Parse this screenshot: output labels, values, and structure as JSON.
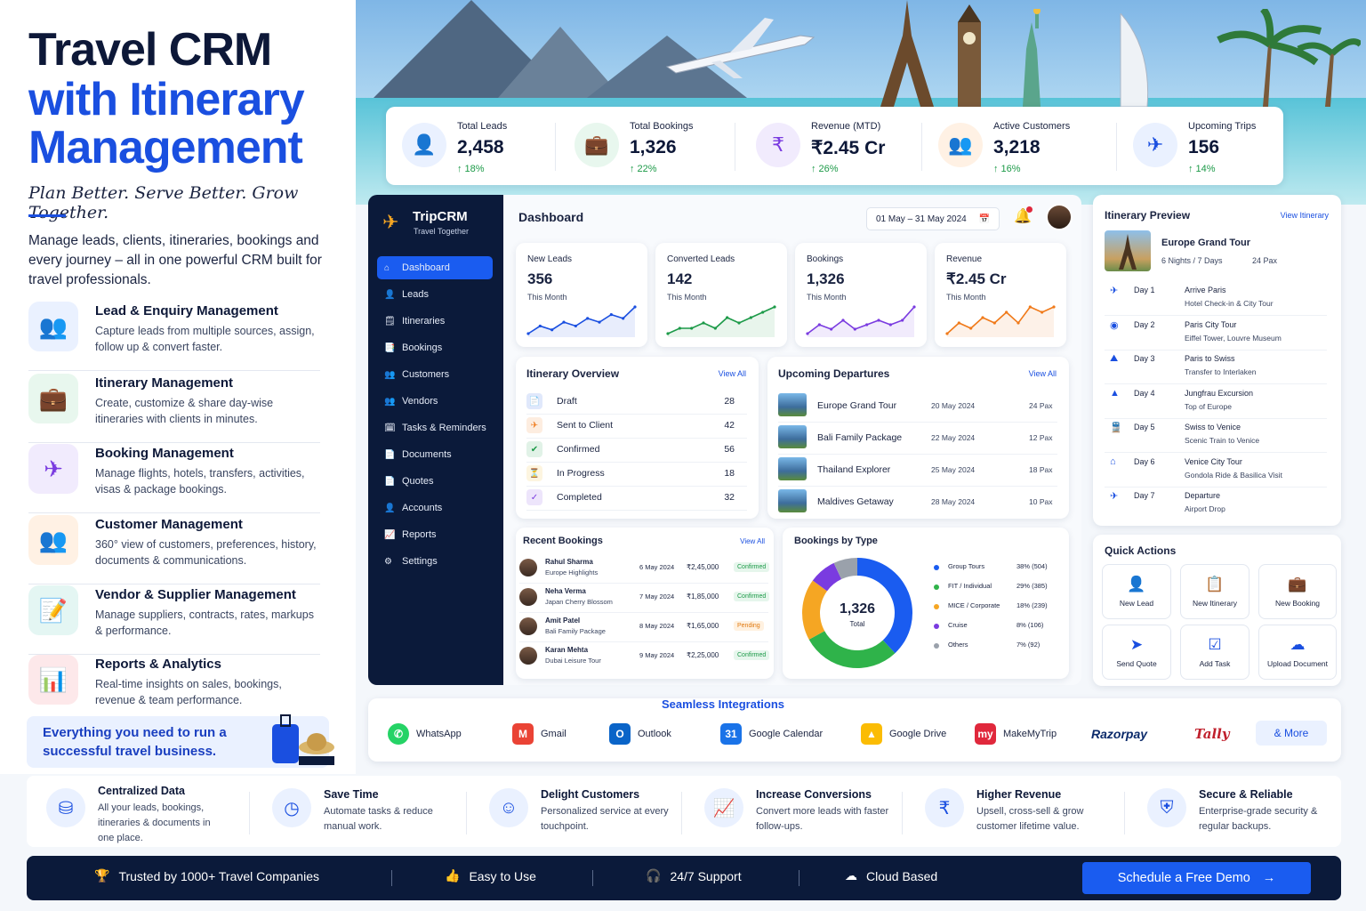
{
  "hero": {
    "title_line1": "Travel CRM",
    "title_line2": "with Itinerary",
    "title_line3": "Management",
    "tagline": "Plan Better. Serve Better. Grow Together.",
    "description": "Manage leads, clients, itineraries, bookings and every journey – all in one powerful CRM built for travel professionals."
  },
  "features": [
    {
      "title": "Lead & Enquiry Management",
      "desc": "Capture leads from multiple sources, assign, follow up & convert faster.",
      "icon": "users-icon",
      "color": "#1a4fe0",
      "bg": "#eaf1ff"
    },
    {
      "title": "Itinerary Management",
      "desc": "Create, customize & share day-wise itineraries with clients in minutes.",
      "icon": "briefcase-icon",
      "color": "#1c9a48",
      "bg": "#e8f7ee"
    },
    {
      "title": "Booking Management",
      "desc": "Manage flights, hotels, transfers, activities, visas & package bookings.",
      "icon": "plane-icon",
      "color": "#7a3be0",
      "bg": "#f1ebfd"
    },
    {
      "title": "Customer Management",
      "desc": "360° view of customers, preferences, history, documents & communications.",
      "icon": "customers-icon",
      "color": "#f07a1a",
      "bg": "#fff1e4"
    },
    {
      "title": "Vendor & Supplier Management",
      "desc": "Manage suppliers, contracts, rates, markups & performance.",
      "icon": "document-icon",
      "color": "#14998a",
      "bg": "#e4f6f3"
    },
    {
      "title": "Reports & Analytics",
      "desc": "Real-time insights on sales, bookings, revenue & team performance.",
      "icon": "chart-icon",
      "color": "#e0283c",
      "bg": "#fde8ea"
    }
  ],
  "promo": {
    "text_line1": "Everything you need to run a",
    "text_line2": "successful travel business."
  },
  "stats": [
    {
      "label": "Total Leads",
      "value": "2,458",
      "growth": "↑ 18%",
      "icon": "user-add-icon",
      "color": "#1a4fe0",
      "bg": "#eaf1ff"
    },
    {
      "label": "Total Bookings",
      "value": "1,326",
      "growth": "↑ 22%",
      "icon": "briefcase-icon",
      "color": "#1c9a48",
      "bg": "#e8f7ee"
    },
    {
      "label": "Revenue (MTD)",
      "value": "₹2.45 Cr",
      "growth": "↑ 26%",
      "icon": "rupee-icon",
      "color": "#7a3be0",
      "bg": "#f1ebfd"
    },
    {
      "label": "Active Customers",
      "value": "3,218",
      "growth": "↑ 16%",
      "icon": "customers-icon",
      "color": "#f07a1a",
      "bg": "#fff1e4"
    },
    {
      "label": "Upcoming Trips",
      "value": "156",
      "growth": "↑ 14%",
      "icon": "plane-icon",
      "color": "#1a4fe0",
      "bg": "#eaf1ff"
    }
  ],
  "sidebar": {
    "brand": "TripCRM",
    "brand_sub": "Travel Together",
    "items": [
      "Dashboard",
      "Leads",
      "Itineraries",
      "Bookings",
      "Customers",
      "Vendors",
      "Tasks & Reminders",
      "Documents",
      "Quotes",
      "Accounts",
      "Reports",
      "Settings"
    ]
  },
  "dashboard": {
    "title": "Dashboard",
    "date_range": "01 May – 31 May 2024"
  },
  "kpis": [
    {
      "label": "New Leads",
      "value": "356",
      "sub": "This Month",
      "color": "#1a4fe0",
      "trend": [
        3,
        5,
        4,
        6,
        5,
        7,
        6,
        8,
        7,
        10
      ]
    },
    {
      "label": "Converted Leads",
      "value": "142",
      "sub": "This Month",
      "color": "#1c9a48",
      "trend": [
        3,
        4,
        4,
        5,
        4,
        6,
        5,
        6,
        7,
        8
      ]
    },
    {
      "label": "Bookings",
      "value": "1,326",
      "sub": "This Month",
      "color": "#7a3be0",
      "trend": [
        3,
        5,
        4,
        6,
        4,
        5,
        6,
        5,
        6,
        9
      ]
    },
    {
      "label": "Revenue",
      "value": "₹2.45 Cr",
      "sub": "This Month",
      "color": "#f07a1a",
      "trend": [
        3,
        5,
        4,
        6,
        5,
        7,
        5,
        8,
        7,
        8
      ]
    }
  ],
  "itinerary_overview": {
    "title": "Itinerary Overview",
    "link": "View All",
    "rows": [
      {
        "label": "Draft",
        "value": "28",
        "color": "#1a4fe0"
      },
      {
        "label": "Sent to Client",
        "value": "42",
        "color": "#f07a1a"
      },
      {
        "label": "Confirmed",
        "value": "56",
        "color": "#1c9a48"
      },
      {
        "label": "In Progress",
        "value": "18",
        "color": "#f0b41a"
      },
      {
        "label": "Completed",
        "value": "32",
        "color": "#7a3be0"
      }
    ]
  },
  "departures": {
    "title": "Upcoming Departures",
    "link": "View All",
    "rows": [
      {
        "name": "Europe Grand Tour",
        "date": "20 May 2024",
        "pax": "24 Pax"
      },
      {
        "name": "Bali Family Package",
        "date": "22 May 2024",
        "pax": "12 Pax"
      },
      {
        "name": "Thailand Explorer",
        "date": "25 May 2024",
        "pax": "18 Pax"
      },
      {
        "name": "Maldives Getaway",
        "date": "28 May 2024",
        "pax": "10 Pax"
      }
    ]
  },
  "recent_bookings": {
    "title": "Recent Bookings",
    "link": "View All",
    "rows": [
      {
        "name": "Rahul Sharma",
        "pkg": "Europe Highlights",
        "date": "6 May 2024",
        "amount": "₹2,45,000",
        "status": "Confirmed"
      },
      {
        "name": "Neha Verma",
        "pkg": "Japan Cherry Blossom",
        "date": "7 May 2024",
        "amount": "₹1,85,000",
        "status": "Confirmed"
      },
      {
        "name": "Amit Patel",
        "pkg": "Bali Family Package",
        "date": "8 May 2024",
        "amount": "₹1,65,000",
        "status": "Pending"
      },
      {
        "name": "Karan Mehta",
        "pkg": "Dubai Leisure Tour",
        "date": "9 May 2024",
        "amount": "₹2,25,000",
        "status": "Confirmed"
      }
    ]
  },
  "chart_data": {
    "type": "pie",
    "title": "Bookings by Type",
    "center_value": "1,326",
    "center_label": "Total",
    "series": [
      {
        "name": "Group Tours",
        "value": 38,
        "count": 504,
        "label": "38% (504)",
        "color": "#1a5cf0"
      },
      {
        "name": "FIT / Individual",
        "value": 29,
        "count": 385,
        "label": "29% (385)",
        "color": "#2fb34a"
      },
      {
        "name": "MICE / Corporate",
        "value": 18,
        "count": 239,
        "label": "18% (239)",
        "color": "#f5a623"
      },
      {
        "name": "Cruise",
        "value": 8,
        "count": 106,
        "label": "8% (106)",
        "color": "#7a3be0"
      },
      {
        "name": "Others",
        "value": 7,
        "count": 92,
        "label": "7% (92)",
        "color": "#9aa1ab"
      }
    ]
  },
  "itinerary_preview": {
    "title": "Itinerary Preview",
    "link": "View Itinerary",
    "trip": "Europe Grand Tour",
    "duration": "6 Nights / 7 Days",
    "pax": "24 Pax",
    "days": [
      {
        "day": "Day 1",
        "title": "Arrive Paris",
        "desc": "Hotel Check-in & City Tour",
        "icon": "✈"
      },
      {
        "day": "Day 2",
        "title": "Paris City Tour",
        "desc": "Eiffel Tower, Louvre Museum",
        "icon": "◉"
      },
      {
        "day": "Day 3",
        "title": "Paris to Swiss",
        "desc": "Transfer to Interlaken",
        "icon": "⛰"
      },
      {
        "day": "Day 4",
        "title": "Jungfrau Excursion",
        "desc": "Top of Europe",
        "icon": "▲"
      },
      {
        "day": "Day 5",
        "title": "Swiss to Venice",
        "desc": "Scenic Train to Venice",
        "icon": "🚆"
      },
      {
        "day": "Day 6",
        "title": "Venice City Tour",
        "desc": "Gondola Ride & Basilica Visit",
        "icon": "⌂"
      },
      {
        "day": "Day 7",
        "title": "Departure",
        "desc": "Airport Drop",
        "icon": "✈"
      }
    ]
  },
  "quick_actions": {
    "title": "Quick Actions",
    "items": [
      {
        "label": "New Lead",
        "icon": "👤"
      },
      {
        "label": "New Itinerary",
        "icon": "📋"
      },
      {
        "label": "New Booking",
        "icon": "💼"
      },
      {
        "label": "Send Quote",
        "icon": "➤"
      },
      {
        "label": "Add Task",
        "icon": "☑"
      },
      {
        "label": "Upload Document",
        "icon": "☁"
      }
    ]
  },
  "integrations": {
    "title": "Seamless Integrations",
    "items": [
      {
        "name": "WhatsApp",
        "color": "#25d366",
        "glyph": "✆"
      },
      {
        "name": "Gmail",
        "color": "#ea4335",
        "glyph": "M"
      },
      {
        "name": "Outlook",
        "color": "#0a64c8",
        "glyph": "O"
      },
      {
        "name": "Google Calendar",
        "color": "#1a73e8",
        "glyph": "31"
      },
      {
        "name": "Google Drive",
        "color": "#fbbc04",
        "glyph": "▲"
      },
      {
        "name": "MakeMyTrip",
        "color": "#e0283c",
        "glyph": "my"
      }
    ],
    "razorpay": "Razorpay",
    "tally": "Tally",
    "more": "& More"
  },
  "benefits": [
    {
      "title": "Centralized Data",
      "desc": "All your leads, bookings, itineraries & documents in one place.",
      "icon": "⛁"
    },
    {
      "title": "Save Time",
      "desc": "Automate tasks & reduce manual work.",
      "icon": "◷"
    },
    {
      "title": "Delight Customers",
      "desc": "Personalized service at every touchpoint.",
      "icon": "☺"
    },
    {
      "title": "Increase Conversions",
      "desc": "Convert more leads with faster follow-ups.",
      "icon": "📈"
    },
    {
      "title": "Higher Revenue",
      "desc": "Upsell, cross-sell & grow customer lifetime value.",
      "icon": "₹"
    },
    {
      "title": "Secure & Reliable",
      "desc": "Enterprise-grade security & regular backups.",
      "icon": "⛨"
    }
  ],
  "footer": {
    "trusted": "Trusted by 1000+ Travel Companies",
    "easy": "Easy to Use",
    "support": "24/7 Support",
    "cloud": "Cloud Based",
    "cta": "Schedule a Free Demo"
  }
}
